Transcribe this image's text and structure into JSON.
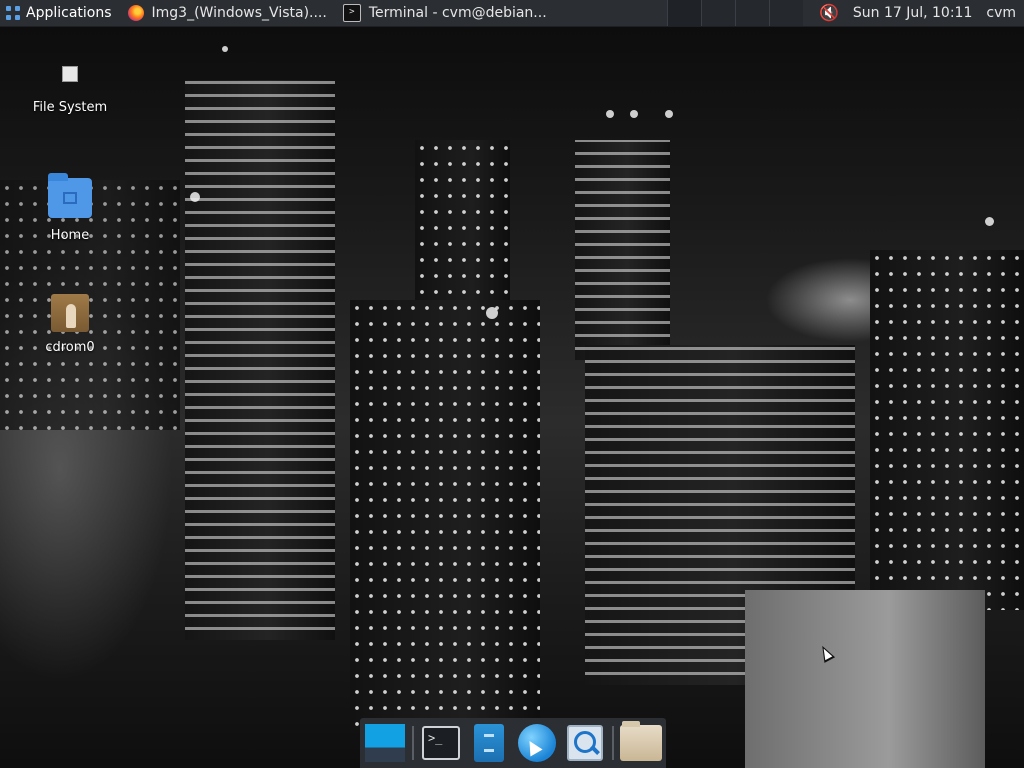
{
  "panel": {
    "applications_label": "Applications",
    "tasks": [
      {
        "title": "Img3_(Windows_Vista)....",
        "icon": "firefox-icon"
      },
      {
        "title": "Terminal - cvm@debian...",
        "icon": "terminal-icon"
      }
    ],
    "clock": "Sun 17 Jul, 10:11",
    "user": "cvm",
    "volume_icon": "speaker-muted-icon"
  },
  "desktop_icons": [
    {
      "label": "File System",
      "icon": "drive-icon"
    },
    {
      "label": "Home",
      "icon": "home-folder-icon"
    },
    {
      "label": "cdrom0",
      "icon": "cdrom-icon"
    }
  ],
  "dock": {
    "items": [
      "show-desktop-icon",
      "terminal-icon",
      "file-manager-icon",
      "web-browser-icon",
      "app-finder-icon",
      "folder-icon"
    ]
  },
  "colors": {
    "panel_bg": "#2b2e33",
    "accent": "#12a2e4"
  }
}
